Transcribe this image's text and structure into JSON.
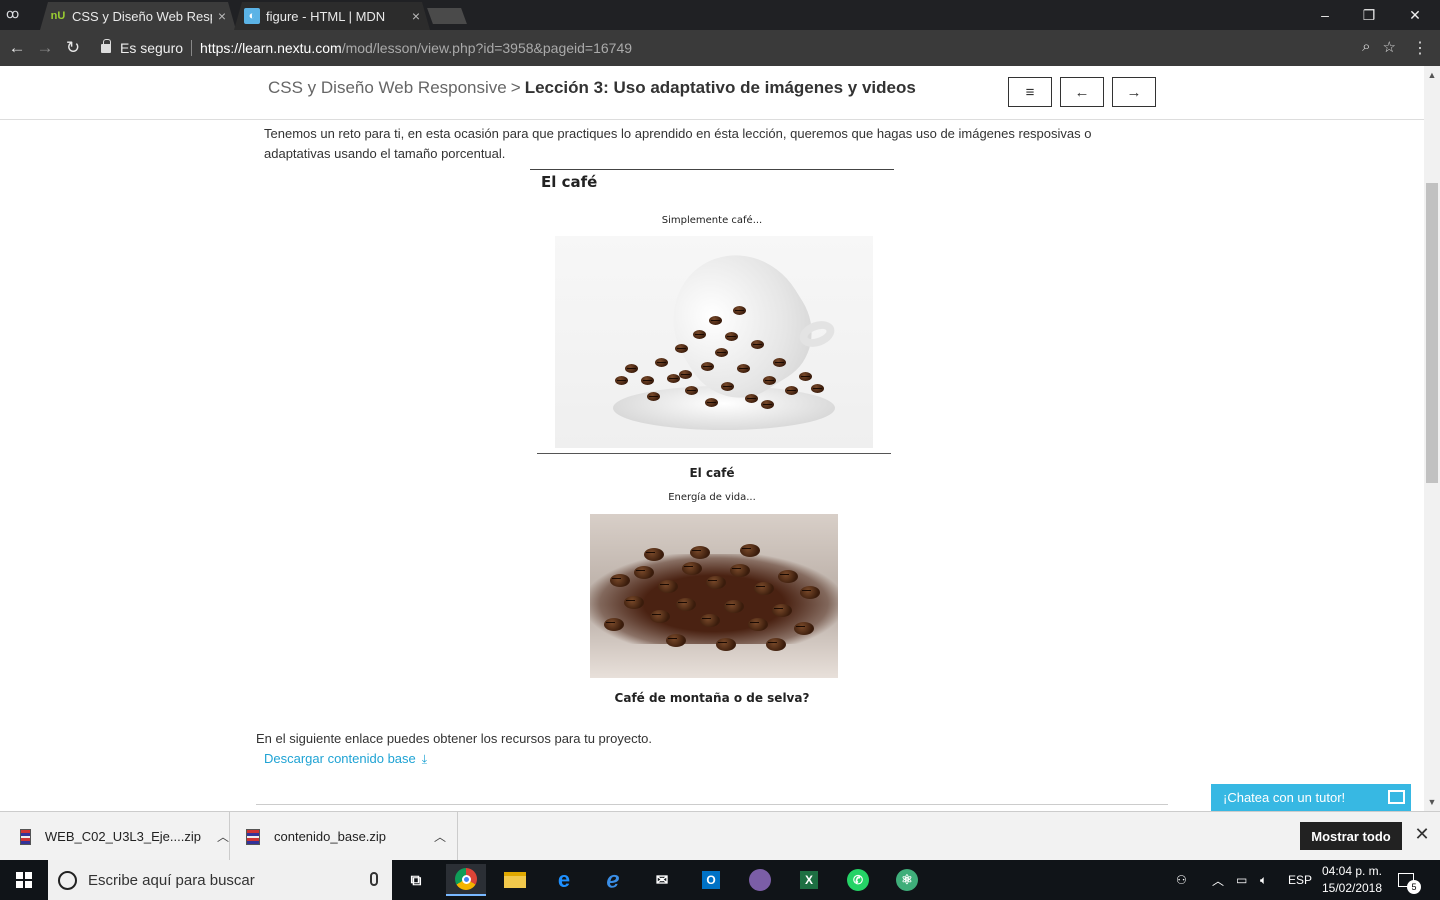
{
  "browser": {
    "tabs": [
      {
        "favicon": "nU",
        "title": "CSS y Diseño Web Respo",
        "close": "×"
      },
      {
        "favicon": "mdn-icon",
        "title": "figure - HTML | MDN",
        "close": "×"
      }
    ],
    "window_controls": {
      "minimize": "–",
      "restore": "❐",
      "close": "✕"
    },
    "secure_label": "Es seguro",
    "url_host": "https://learn.nextu.com",
    "url_path": "/mod/lesson/view.php?id=3958&pageid=16749"
  },
  "page": {
    "breadcrumb_course": "CSS y Diseño Web Responsive",
    "breadcrumb_sep": ">",
    "breadcrumb_lesson": "Lección 3: Uso adaptativo de imágenes y videos",
    "nav_menu": "≡",
    "nav_prev": "←",
    "nav_next": "→",
    "intro": "Tenemos un reto para ti, en esta ocasión para que practiques lo aprendido en ésta lección, queremos que hagas uso de imágenes resposivas o adaptativas usando el tamaño porcentual.",
    "figure": {
      "title": "El café",
      "subtitle1": "Simplemente café...",
      "caption1": "El café",
      "subtitle2": "Energía de vida...",
      "caption2": "Café de montaña o de selva?"
    },
    "resources_text": "En el siguiente enlace puedes obtener los recursos para tu proyecto.",
    "download_link": "Descargar contenido base",
    "chat_button": "¡Chatea con un tutor!"
  },
  "downloads": {
    "items": [
      {
        "name": "WEB_C02_U3L3_Eje....zip"
      },
      {
        "name": "contenido_base.zip"
      }
    ],
    "show_all": "Mostrar todo",
    "close": "✕"
  },
  "taskbar": {
    "search_placeholder": "Escribe aquí para buscar",
    "language": "ESP",
    "time": "04:04 p. m.",
    "date": "15/02/2018",
    "notifications": "5"
  }
}
